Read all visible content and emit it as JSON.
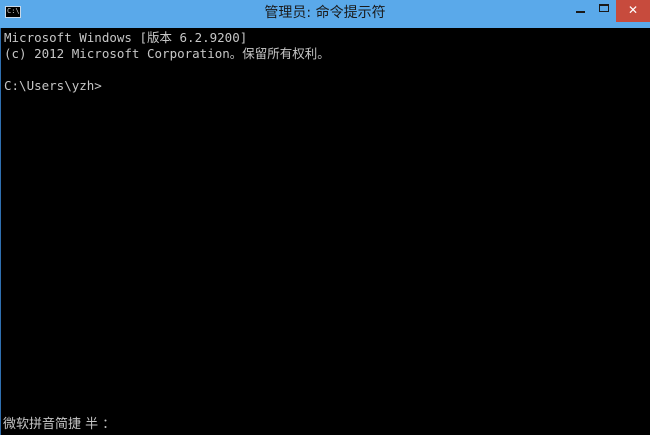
{
  "window": {
    "title": "管理员: 命令提示符",
    "icon_glyph": "C:\\",
    "icon": "cmd-prompt-icon",
    "buttons": {
      "minimize_icon": "minimize-icon",
      "maximize_icon": "maximize-icon",
      "close_icon": "close-icon",
      "close_glyph": "✕"
    },
    "colors": {
      "titlebar": "#5aa9ea",
      "close_button": "#c74b3d",
      "console_background": "#000000",
      "console_text": "#c6c6c6"
    }
  },
  "console": {
    "lines": [
      "Microsoft Windows [版本 6.2.9200]",
      "(c) 2012 Microsoft Corporation。保留所有权利。",
      "C:\\Users\\yzh>"
    ]
  },
  "ime": {
    "status": "微软拼音简捷 半 ："
  }
}
